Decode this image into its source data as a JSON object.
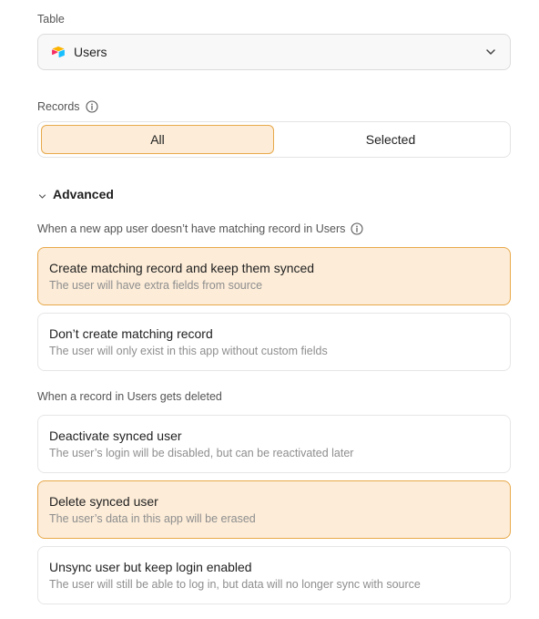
{
  "table": {
    "label": "Table",
    "selected_value": "Users",
    "table_icon": "airtable-logo-icon",
    "dropdown_icon": "chevron-down-icon"
  },
  "records": {
    "label": "Records",
    "options": [
      "All",
      "Selected"
    ],
    "selected": "All"
  },
  "advanced": {
    "label": "Advanced",
    "expanded": true
  },
  "no_match": {
    "question": "When a new app user doesn’t have matching record in Users",
    "options": [
      {
        "title": "Create matching record and keep them synced",
        "description": "The user will have extra fields from source",
        "selected": true
      },
      {
        "title": "Don’t create matching record",
        "description": "The user will only exist in this app without custom fields",
        "selected": false
      }
    ]
  },
  "deleted": {
    "question": "When a record in Users gets deleted",
    "options": [
      {
        "title": "Deactivate synced user",
        "description": "The user’s login will be disabled, but can be reactivated later",
        "selected": false
      },
      {
        "title": "Delete synced user",
        "description": "The user’s data in this app will be erased",
        "selected": true
      },
      {
        "title": "Unsync user but keep login enabled",
        "description": "The user will still be able to log in, but data will no longer sync with source",
        "selected": false
      }
    ]
  },
  "colors": {
    "accent_bg": "#fcecd8",
    "accent_border": "#e8a94a"
  }
}
